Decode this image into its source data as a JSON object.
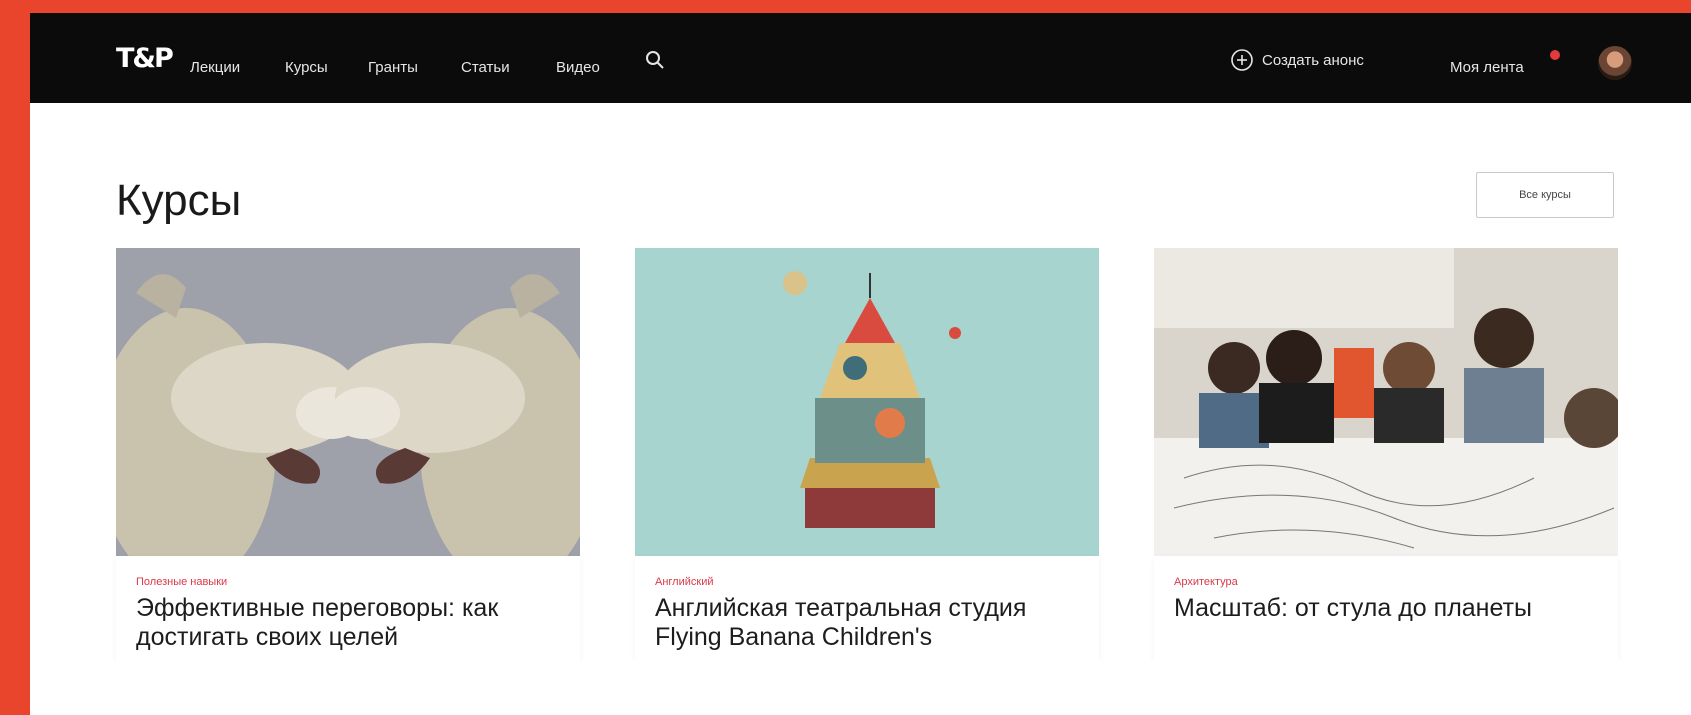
{
  "navbar": {
    "logo": "T&P",
    "links": [
      "Лекции",
      "Курсы",
      "Гранты",
      "Статьи",
      "Видео"
    ],
    "create_label": "Создать анонс",
    "feed_label": "Моя лента"
  },
  "section": {
    "title": "Курсы",
    "all_button": "Все курсы"
  },
  "cards": [
    {
      "category": "Полезные навыки",
      "title": "Эффективные переговоры: как достигать своих целей"
    },
    {
      "category": "Английский",
      "title": "Английская театральная студия Flying Banana Children's"
    },
    {
      "category": "Архитектура",
      "title": "Масштаб: от стула до планеты"
    }
  ],
  "colors": {
    "frame": "#e8452c",
    "navbar_bg": "#0b0b0b",
    "category": "#d8394a",
    "notification": "#e23b3b"
  },
  "icons": [
    "search-icon",
    "plus-circle-icon",
    "notification-dot",
    "avatar"
  ]
}
